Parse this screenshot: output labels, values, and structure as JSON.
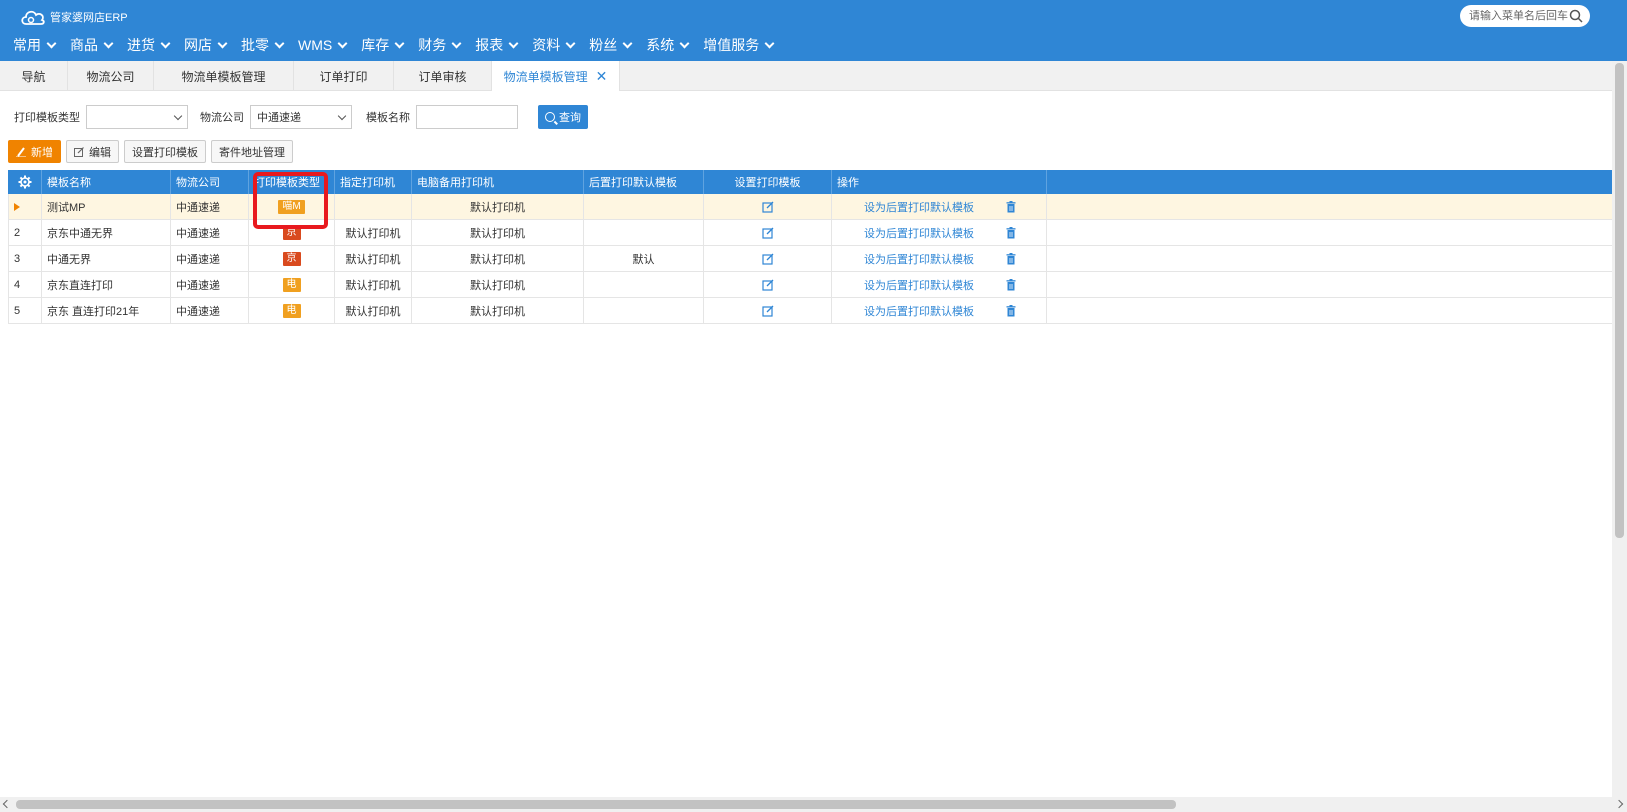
{
  "app": {
    "logo_text": "管家婆网店ERP",
    "search_placeholder": "请输入菜单名后回车"
  },
  "menu": [
    {
      "label": "常用"
    },
    {
      "label": "商品"
    },
    {
      "label": "进货"
    },
    {
      "label": "网店"
    },
    {
      "label": "批零"
    },
    {
      "label": "WMS"
    },
    {
      "label": "库存"
    },
    {
      "label": "财务"
    },
    {
      "label": "报表"
    },
    {
      "label": "资料"
    },
    {
      "label": "粉丝"
    },
    {
      "label": "系统"
    },
    {
      "label": "增值服务"
    }
  ],
  "tabs": [
    {
      "label": "导航",
      "active": false
    },
    {
      "label": "物流公司",
      "active": false
    },
    {
      "label": "物流单模板管理",
      "active": false
    },
    {
      "label": "订单打印",
      "active": false
    },
    {
      "label": "订单审核",
      "active": false
    },
    {
      "label": "物流单模板管理",
      "active": true
    }
  ],
  "filters": {
    "print_type_label": "打印模板类型",
    "print_type_value": "",
    "logistics_label": "物流公司",
    "logistics_value": "中通速递",
    "template_name_label": "模板名称",
    "template_name_value": "",
    "query_label": "查询"
  },
  "toolbar": {
    "add": "新增",
    "edit": "编辑",
    "set_print_template": "设置打印模板",
    "sender_address": "寄件地址管理"
  },
  "grid": {
    "columns": [
      "模板名称",
      "物流公司",
      "打印模板类型",
      "指定打印机",
      "电脑备用打印机",
      "后置打印默认模板",
      "设置打印模板",
      "操作"
    ],
    "action_link": "设为后置打印默认模板",
    "rows": [
      {
        "idx": "",
        "name": "测试MP",
        "company": "中通速递",
        "type": "喵M",
        "type_color": "#f0a020",
        "printer": "",
        "backup": "默认打印机",
        "post_default": "",
        "selected": true
      },
      {
        "idx": "2",
        "name": "京东中通无界",
        "company": "中通速递",
        "type": "京",
        "type_color": "#d94a1e",
        "printer": "默认打印机",
        "backup": "默认打印机",
        "post_default": "",
        "selected": false
      },
      {
        "idx": "3",
        "name": "中通无界",
        "company": "中通速递",
        "type": "京",
        "type_color": "#d94a1e",
        "printer": "默认打印机",
        "backup": "默认打印机",
        "post_default": "默认",
        "selected": false
      },
      {
        "idx": "4",
        "name": "京东直连打印",
        "company": "中通速递",
        "type": "电",
        "type_color": "#f0a020",
        "printer": "默认打印机",
        "backup": "默认打印机",
        "post_default": "",
        "selected": false
      },
      {
        "idx": "5",
        "name": "京东 直连打印21年",
        "company": "中通速递",
        "type": "电",
        "type_color": "#f0a020",
        "printer": "默认打印机",
        "backup": "默认打印机",
        "post_default": "",
        "selected": false
      }
    ]
  },
  "colors": {
    "header_bg": "#2f86d5",
    "accent_orange": "#f08300",
    "highlight_red": "#e8191e"
  }
}
